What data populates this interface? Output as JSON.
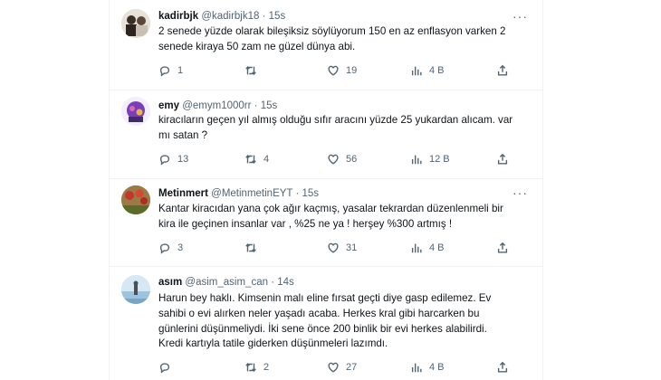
{
  "tweets": [
    {
      "name": "kadirbjk",
      "handle": "@kadirbjk18",
      "dot": "·",
      "time": "15s",
      "lines": [
        "2 senede yüzde olarak bileşiksiz söylüyorum 150 en az enflasyon varken 2",
        "senede kiraya 50 zam ne güzel dünya abi."
      ],
      "replies": "1",
      "retweets": "",
      "likes": "19",
      "views": "4 B"
    },
    {
      "name": "emy",
      "handle": "@emym1000rr",
      "dot": "·",
      "time": "15s",
      "lines": [
        "kiracıların geçen yıl almış olduğu sıfır aracını yüzde 25 yukardan alıcam. var",
        "mı satan ?"
      ],
      "replies": "13",
      "retweets": "4",
      "likes": "56",
      "views": "12 B"
    },
    {
      "name": "Metinmert",
      "handle": "@MetinmetinEYT",
      "dot": "·",
      "time": "15s",
      "lines": [
        "Kantar kiracıdan yana çok ağır kaçmış,  yasalar tekrardan düzenlenmeli bir",
        "kira ile geçinen insanlar var , %25 ne ya ! herşey %300 artmış !"
      ],
      "replies": "3",
      "retweets": "",
      "likes": "31",
      "views": "4 B"
    },
    {
      "name": "asım",
      "handle": "@asim_asim_can",
      "dot": "·",
      "time": "14s",
      "lines": [
        "Harun bey haklı. Kimsenin malı eline fırsat geçti diye gasp edilemez. Ev",
        "sahibi o evi alırken neler yaşadı acaba. Herkes kral gibi harcarken bu",
        "günlerini düşünmeliydi. İki sene önce 200 binlik bir evi herkes alabilirdi.",
        "Kredi kartıyla tatile giderken düşünmeleri lazımdı."
      ],
      "replies": "",
      "retweets": "2",
      "likes": "27",
      "views": "4 B"
    }
  ],
  "more_label": "···",
  "icons": [
    "reply-icon",
    "retweet-icon",
    "like-icon",
    "views-icon",
    "share-icon"
  ],
  "colors": {
    "text": "#0f1419",
    "muted": "#536471",
    "border": "#eff3f4"
  }
}
